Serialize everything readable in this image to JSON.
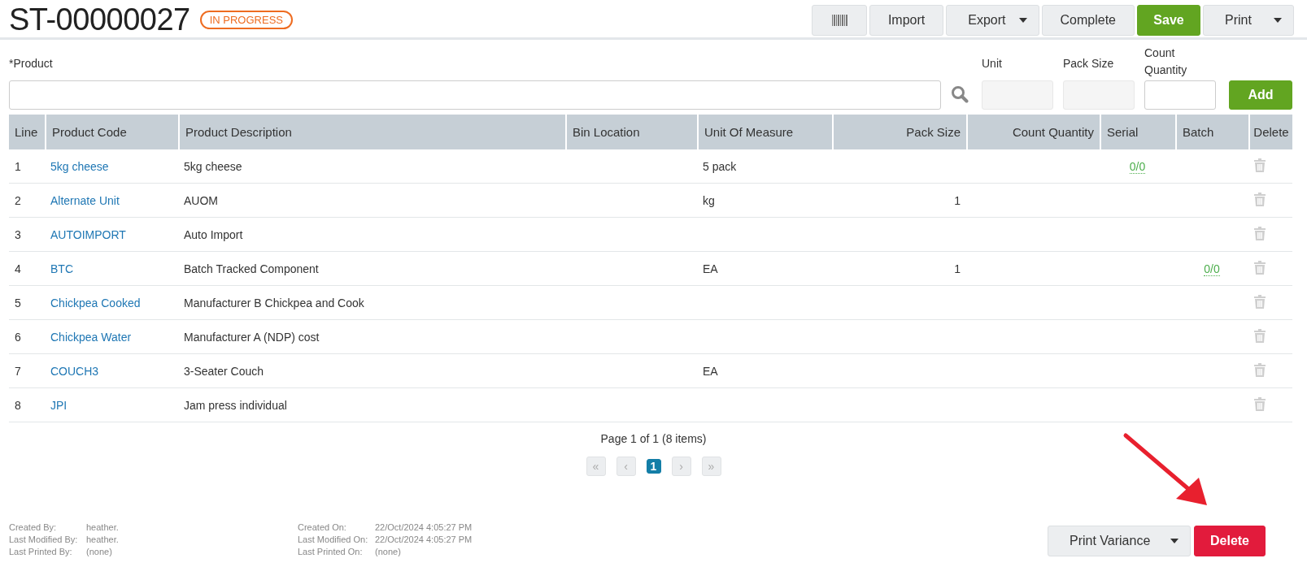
{
  "header": {
    "title": "ST-00000027",
    "status": "IN PROGRESS"
  },
  "toolbar": [
    {
      "kind": "barcode"
    },
    {
      "kind": "plain",
      "label": "Import"
    },
    {
      "kind": "dropdown",
      "label": "Export"
    },
    {
      "kind": "plain",
      "label": "Complete"
    },
    {
      "kind": "primary",
      "label": "Save"
    },
    {
      "kind": "dropdown",
      "label": "Print"
    }
  ],
  "entry": {
    "product_label": "*Product",
    "unit_label": "Unit",
    "pack_size_label": "Pack Size",
    "count_quantity_label": "Count Quantity",
    "add_button": "Add"
  },
  "table": {
    "columns": [
      {
        "label": "Line",
        "kind": "text"
      },
      {
        "label": "Product Code",
        "kind": "text"
      },
      {
        "label": "Product Description",
        "kind": "text"
      },
      {
        "label": "Bin Location",
        "kind": "text"
      },
      {
        "label": "Unit Of Measure",
        "kind": "text"
      },
      {
        "label": "Pack Size",
        "kind": "number"
      },
      {
        "label": "Count Quantity",
        "kind": "number"
      },
      {
        "label": "Serial",
        "kind": "center"
      },
      {
        "label": "Batch",
        "kind": "center"
      },
      {
        "label": "Delete",
        "kind": "action"
      }
    ],
    "rows": [
      {
        "line": "1",
        "code": "5kg cheese",
        "description": "5kg cheese",
        "uom": "5 pack",
        "serial": "0/0"
      },
      {
        "line": "2",
        "code": "Alternate Unit",
        "description": "AUOM",
        "uom": "kg",
        "pack_size": "1"
      },
      {
        "line": "3",
        "code": "AUTOIMPORT",
        "description": "Auto Import"
      },
      {
        "line": "4",
        "code": "BTC",
        "description": "Batch Tracked Component",
        "uom": "EA",
        "pack_size": "1",
        "batch": "0/0"
      },
      {
        "line": "5",
        "code": "Chickpea Cooked",
        "description": "Manufacturer B Chickpea and Cook"
      },
      {
        "line": "6",
        "code": "Chickpea Water",
        "description": "Manufacturer A (NDP) cost"
      },
      {
        "line": "7",
        "code": "COUCH3",
        "description": "3-Seater Couch",
        "uom": "EA"
      },
      {
        "line": "8",
        "code": "JPI",
        "description": "Jam press individual"
      }
    ]
  },
  "pagination": {
    "summary": "Page 1 of 1 (8 items)",
    "buttons": [
      {
        "label": "«",
        "selected": false
      },
      {
        "label": "‹",
        "selected": false
      },
      {
        "label": "1",
        "selected": true
      },
      {
        "label": "›",
        "selected": false
      },
      {
        "label": "»",
        "selected": false
      }
    ]
  },
  "audit": [
    [
      {
        "label": "Created By:",
        "value": "heather."
      },
      {
        "label": "Last Modified By:",
        "value": "heather."
      },
      {
        "label": "Last Printed By:",
        "value": "(none)"
      }
    ],
    [
      {
        "label": "Created On:",
        "value": "22/Oct/2024 4:05:27 PM"
      },
      {
        "label": "Last Modified On:",
        "value": "22/Oct/2024 4:05:27 PM"
      },
      {
        "label": "Last Printed On:",
        "value": "(none)"
      }
    ]
  ],
  "footer_buttons": [
    {
      "kind": "dropdown",
      "label": "Print Variance"
    },
    {
      "kind": "danger",
      "label": "Delete"
    }
  ]
}
